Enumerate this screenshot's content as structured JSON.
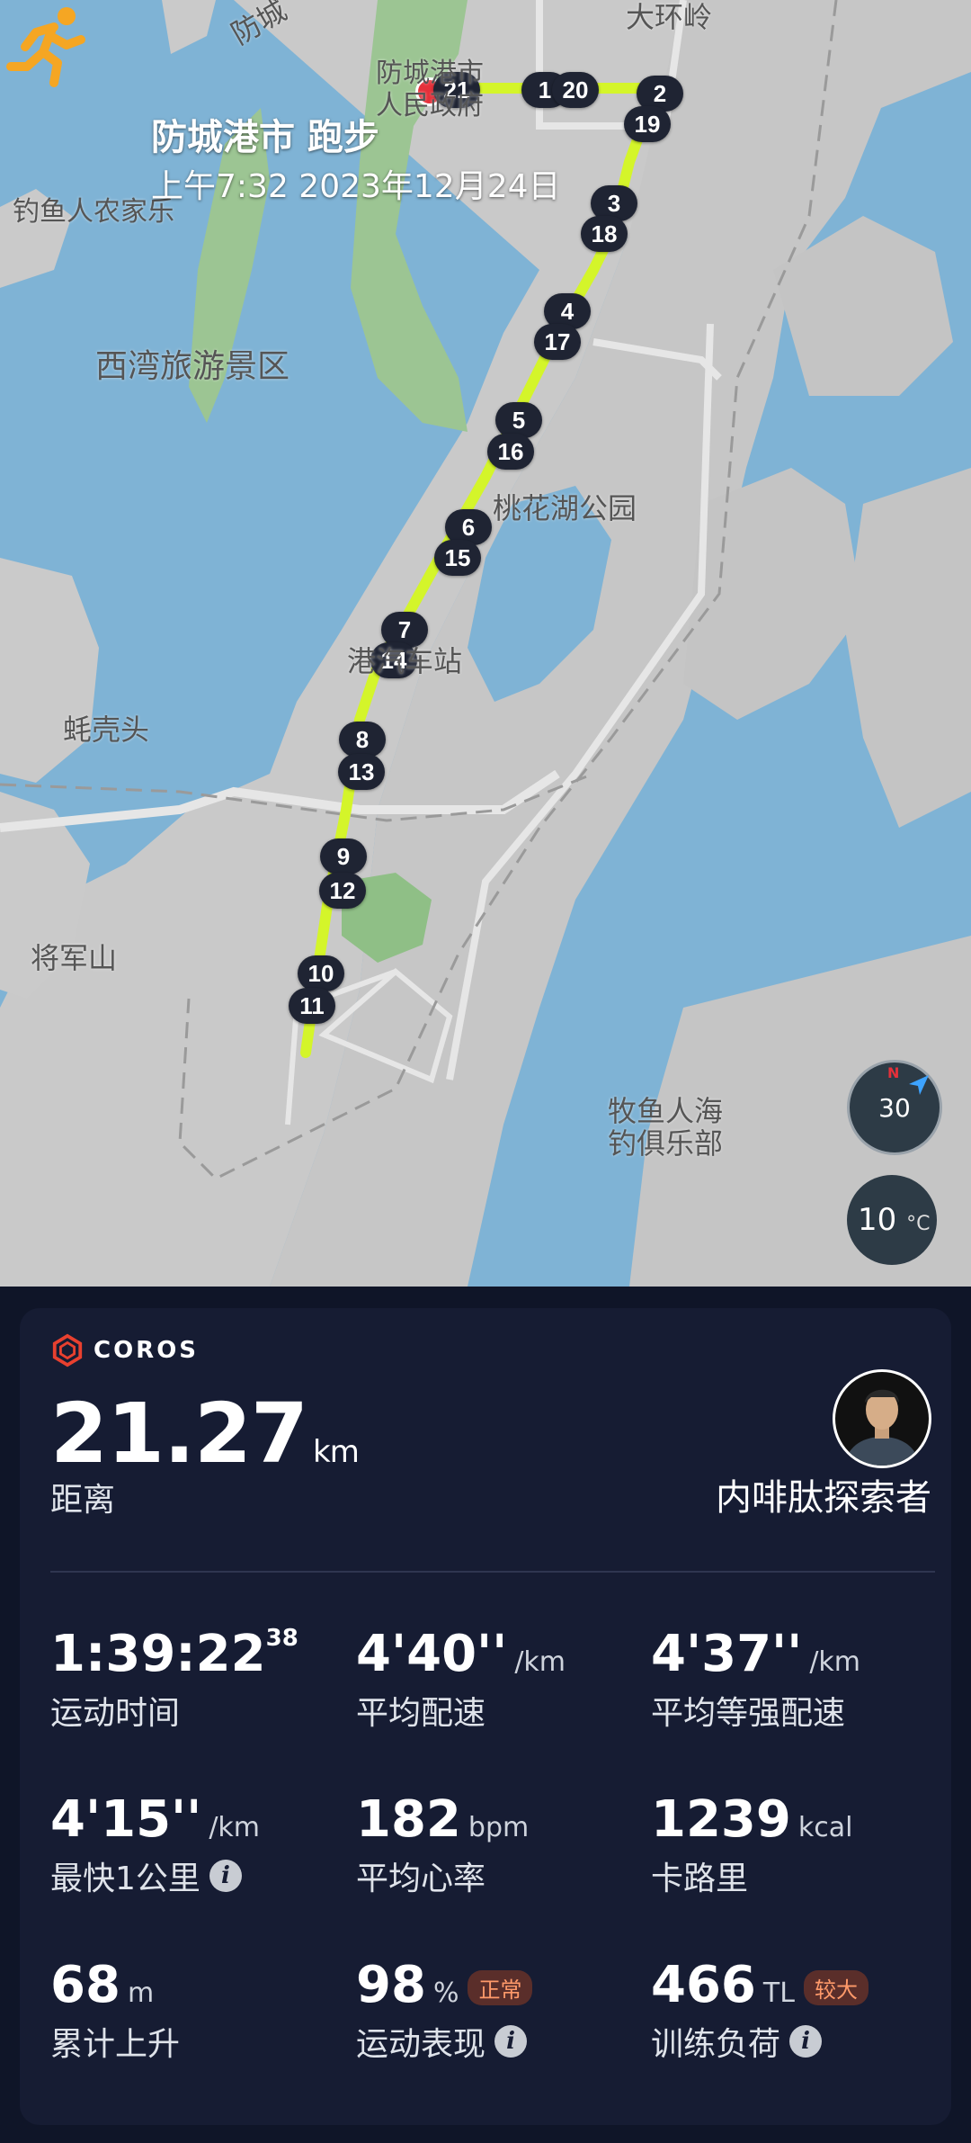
{
  "map": {
    "title": "防城港市 跑步",
    "subtitle": "上午7:32 2023年12月24日",
    "labels": [
      {
        "text": "防城",
        "cls": "dark"
      },
      {
        "text": "大环岭",
        "cls": "dark"
      },
      {
        "text": "防城港市",
        "cls": "dark"
      },
      {
        "text": "人民政府",
        "cls": "dark"
      },
      {
        "text": "钓鱼人农家乐",
        "cls": "dark"
      },
      {
        "text": "西湾旅游景区",
        "cls": "dark"
      },
      {
        "text": "桃花湖公园",
        "cls": "dark"
      },
      {
        "text": "港汽车站",
        "cls": "dark"
      },
      {
        "text": "蚝壳头",
        "cls": "dark"
      },
      {
        "text": "将军山",
        "cls": "dark"
      },
      {
        "text": "牧鱼人海",
        "cls": "dark"
      },
      {
        "text": "钓俱乐部",
        "cls": "dark"
      }
    ],
    "km_markers": [
      "1",
      "2",
      "3",
      "4",
      "5",
      "6",
      "7",
      "8",
      "9",
      "10",
      "11",
      "12",
      "13",
      "14",
      "15",
      "16",
      "17",
      "18",
      "19",
      "20",
      "21"
    ],
    "compass_value": "30",
    "compass_north": "N",
    "temperature": "10",
    "temperature_unit": "°C",
    "colors": {
      "route": "#d4f52a",
      "water": "#7fb3d5",
      "land": "#c8c8c8",
      "marker": "#1f2433",
      "start": "#e5303a"
    }
  },
  "card": {
    "brand": "COROS",
    "distance_value": "21.27",
    "distance_unit": "km",
    "distance_label": "距离",
    "username": "内啡肽探索者",
    "stats": [
      {
        "value": "1:39:22",
        "sup": "38",
        "unit": "",
        "label": "运动时间"
      },
      {
        "value": "4'40''",
        "unit": "/km",
        "label": "平均配速"
      },
      {
        "value": "4'37''",
        "unit": "/km",
        "label": "平均等强配速"
      },
      {
        "value": "4'15''",
        "unit": "/km",
        "label": "最快1公里"
      },
      {
        "value": "182",
        "unit": "bpm",
        "label": "平均心率"
      },
      {
        "value": "1239",
        "unit": "kcal",
        "label": "卡路里"
      },
      {
        "value": "68",
        "unit": "m",
        "label": "累计上升"
      },
      {
        "value": "98",
        "unit": "%",
        "badge": "正常",
        "label": "运动表现"
      },
      {
        "value": "466",
        "unit": "TL",
        "badge": "较大",
        "label": "训练负荷"
      }
    ],
    "colors": {
      "card_bg": "#161c33",
      "badge_text": "#ff9a6a",
      "badge_bg": "#5a2e2a"
    }
  }
}
